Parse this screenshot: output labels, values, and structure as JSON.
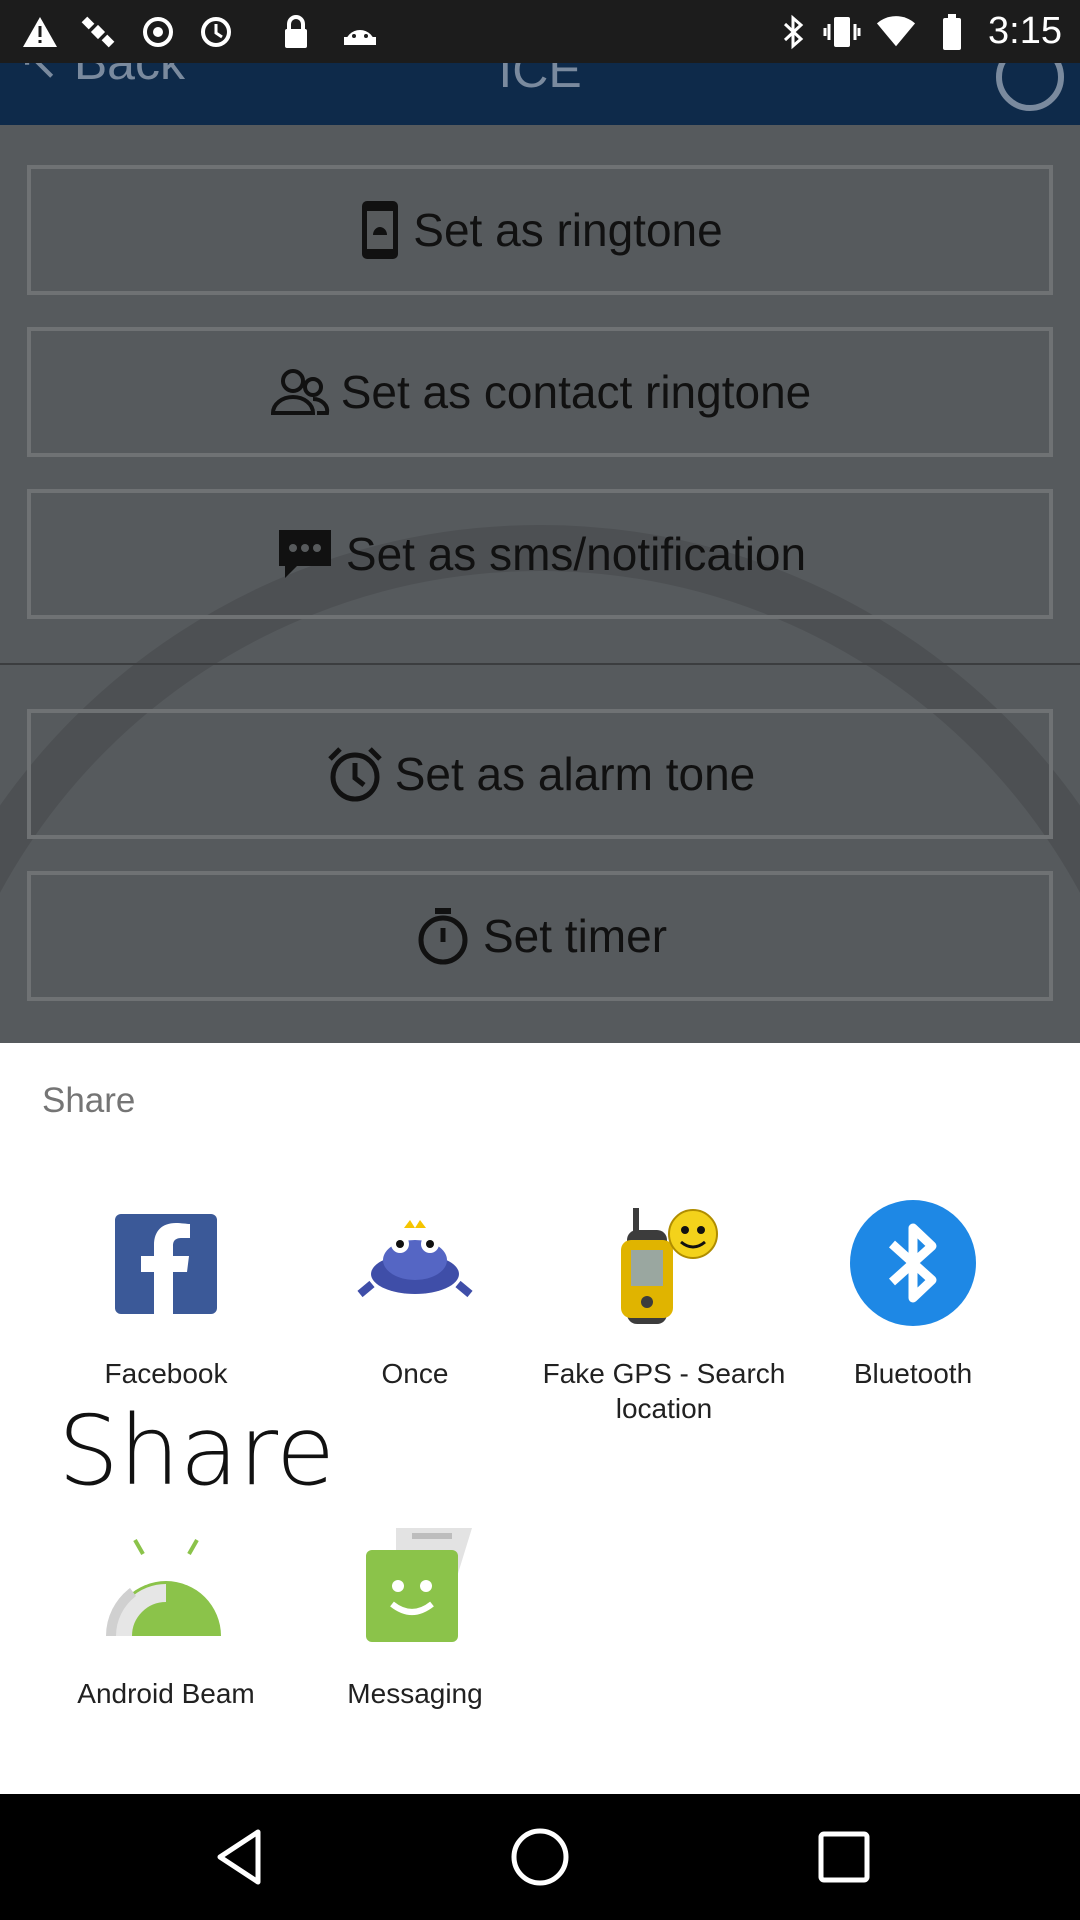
{
  "status_bar": {
    "time": "3:15"
  },
  "app_bar": {
    "back_label": "Back",
    "title": "ICE"
  },
  "options": [
    {
      "label": "Set as ringtone",
      "icon": "phone-bell-icon"
    },
    {
      "label": "Set as contact ringtone",
      "icon": "contacts-icon"
    },
    {
      "label": "Set as sms/notification",
      "icon": "chat-bubble-icon"
    },
    {
      "label": "Set as alarm tone",
      "icon": "alarm-clock-icon"
    },
    {
      "label": "Set timer",
      "icon": "stopwatch-icon"
    }
  ],
  "share": {
    "title": "Share",
    "overlay_text": "Share",
    "apps": [
      {
        "label": "Facebook",
        "icon": "facebook-icon"
      },
      {
        "label": "Once",
        "icon": "frog-icon"
      },
      {
        "label": "Fake GPS - Search location",
        "icon": "gps-device-icon"
      },
      {
        "label": "Bluetooth",
        "icon": "bluetooth-icon"
      },
      {
        "label": "Android Beam",
        "icon": "android-beam-icon"
      },
      {
        "label": "Messaging",
        "icon": "messaging-icon"
      }
    ]
  },
  "colors": {
    "sheet_bg": "#ffffff",
    "facebook": "#3b5998",
    "bluetooth": "#1e88e5",
    "android": "#8bc34a"
  }
}
